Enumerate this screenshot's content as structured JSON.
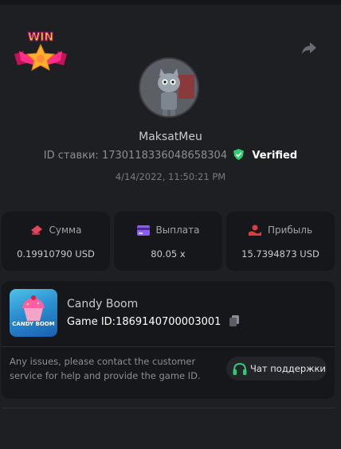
{
  "header": {
    "badge_text": "WIN",
    "username": "MaksatMeu",
    "bet_id_label": "ID ставки:",
    "bet_id_value": "1730118336048658304",
    "verified_label": "Verified",
    "datetime": "4/14/2022, 11:50:21 PM"
  },
  "stats": [
    {
      "label": "Сумма",
      "value": "0.19910790 USD",
      "icon": "money-icon"
    },
    {
      "label": "Выплата",
      "value": "80.05 x",
      "icon": "card-icon"
    },
    {
      "label": "Прибыль",
      "value": "15.7394873 USD",
      "icon": "profit-icon"
    }
  ],
  "game": {
    "thumb_text": "CANDY BOOM",
    "name": "Candy Boom",
    "id_label": "Game ID:",
    "id_value": "1869140700003001",
    "issue_text": "Any issues, please contact the customer service for help and provide the game ID.",
    "support_label": "Чат поддержки"
  },
  "colors": {
    "background": "#1e1f23",
    "card": "#16171b",
    "verified": "#2ecc71",
    "money_icon": "#e0475d",
    "card_icon": "#8b5cf6",
    "profit_icon": "#e03b3b",
    "headset": "#2ecc71"
  }
}
